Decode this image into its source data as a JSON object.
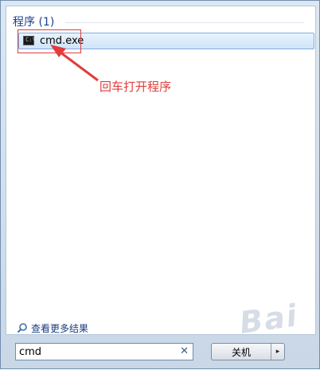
{
  "results": {
    "section_title": "程序 (1)",
    "items": [
      {
        "label": "cmd.exe",
        "icon": "cmd-icon"
      }
    ],
    "see_more_label": "查看更多结果"
  },
  "annotation": {
    "text": "回车打开程序",
    "color": "#e23c3c"
  },
  "search": {
    "value": "cmd",
    "clear_icon": "clear-icon"
  },
  "shutdown": {
    "label": "关机",
    "arrow": "▸"
  },
  "watermark": "Bai"
}
